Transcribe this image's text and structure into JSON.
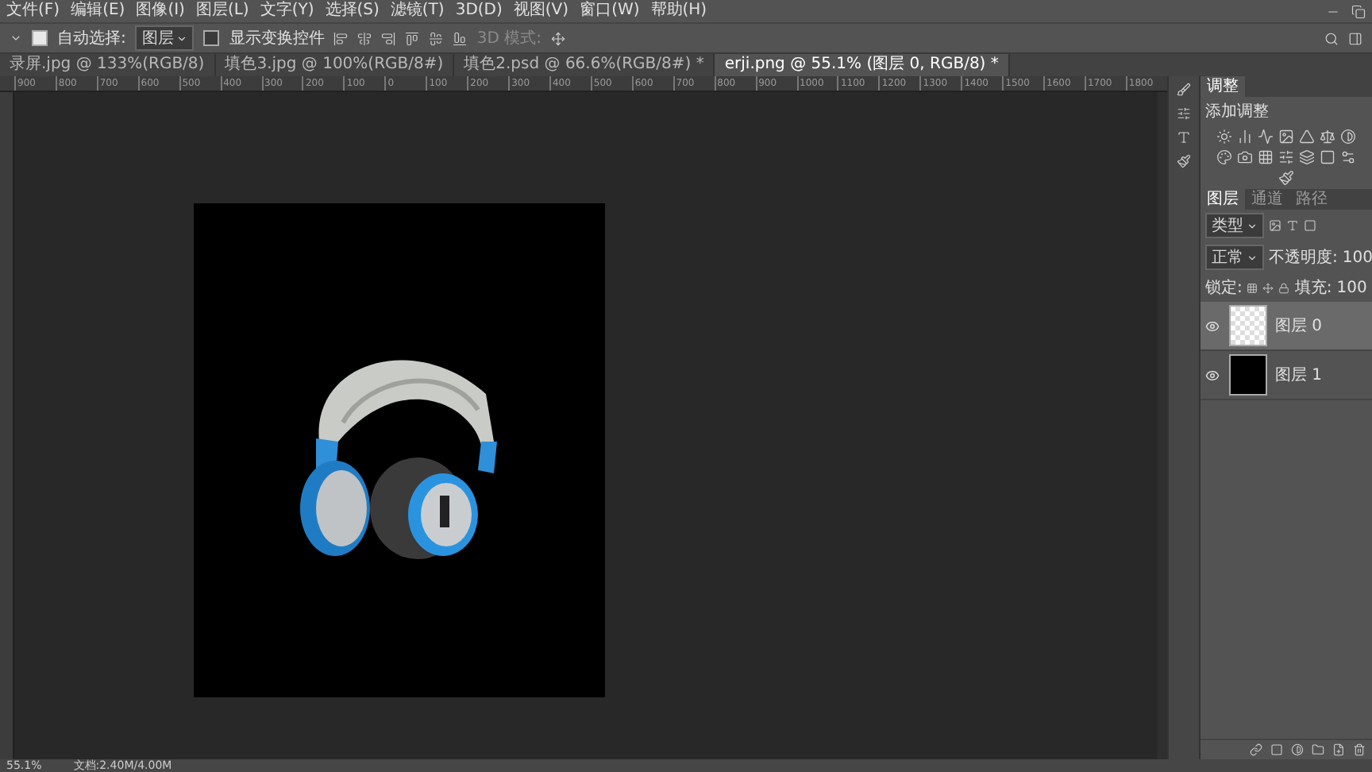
{
  "menu": [
    "文件(F)",
    "编辑(E)",
    "图像(I)",
    "图层(L)",
    "文字(Y)",
    "选择(S)",
    "滤镜(T)",
    "3D(D)",
    "视图(V)",
    "窗口(W)",
    "帮助(H)"
  ],
  "options": {
    "auto_select": {
      "label": "自动选择:",
      "checked": true,
      "value": "图层"
    },
    "show_transform": {
      "label": "显示变换控件",
      "checked": false
    },
    "mode_3d": {
      "label": "3D 模式:",
      "disabled": true
    }
  },
  "tabs": [
    {
      "label": "录屏.jpg @ 133%(RGB/8)",
      "selected": false
    },
    {
      "label": "填色3.jpg @ 100%(RGB/8#)",
      "selected": false
    },
    {
      "label": "填色2.psd @ 66.6%(RGB/8#) *",
      "selected": false
    },
    {
      "label": "erji.png @ 55.1% (图层 0, RGB/8) *",
      "selected": true
    }
  ],
  "ruler_ticks": [
    "900",
    "800",
    "700",
    "600",
    "500",
    "400",
    "300",
    "200",
    "100",
    "0",
    "100",
    "200",
    "300",
    "400",
    "500",
    "600",
    "700",
    "800",
    "900",
    "1000",
    "1100",
    "1200",
    "1300",
    "1400",
    "1500",
    "1600",
    "1700",
    "1800"
  ],
  "adjustments": {
    "tab": "调整",
    "title": "添加调整"
  },
  "layers_panel": {
    "tabs": [
      {
        "label": "图层",
        "selected": true
      },
      {
        "label": "通道",
        "selected": false
      },
      {
        "label": "路径",
        "selected": false
      }
    ],
    "filter": "类型",
    "blend": "正常",
    "opacity_label": "不透明度:",
    "opacity": "100",
    "lock_label": "锁定:",
    "fill_label": "填充:",
    "fill": "100",
    "layers": [
      {
        "name": "图层 0",
        "visible": true,
        "selected": true,
        "kind": "transparent"
      },
      {
        "name": "图层 1",
        "visible": true,
        "selected": false,
        "kind": "black"
      }
    ]
  },
  "status": {
    "zoom": "55.1%",
    "doc": "文档:2.40M/4.00M"
  }
}
